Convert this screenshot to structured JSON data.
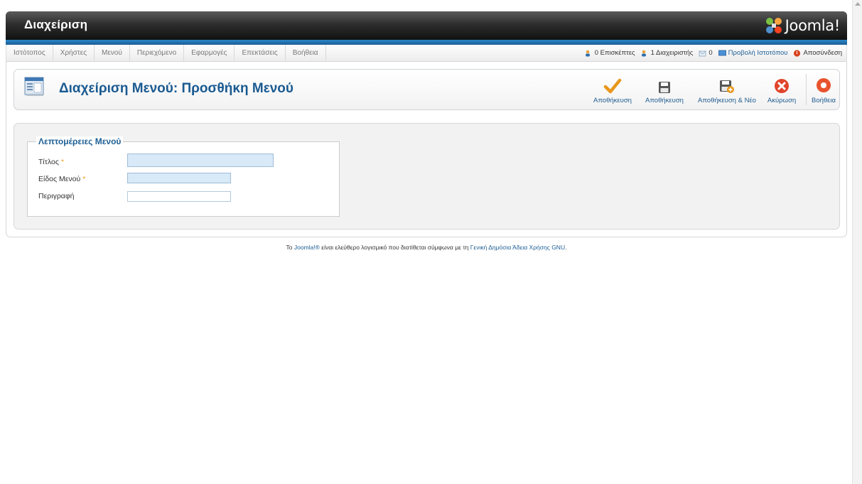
{
  "header": {
    "title": "Διαχείριση",
    "logo_text": "Joomla!"
  },
  "menu": {
    "items": [
      "Ιστότοπος",
      "Χρήστες",
      "Μενού",
      "Περιεχόμενο",
      "Εφαρμογές",
      "Επεκτάσεις",
      "Βοήθεια"
    ]
  },
  "status": {
    "visitors": "0 Επισκέπτες",
    "admins": "1 Διαχειριστής",
    "messages": "0",
    "view_site": "Προβολή Ιστοτόπου",
    "logout": "Αποσύνδεση"
  },
  "toolbar": {
    "page_title": "Διαχείριση Μενού: Προσθήκη Μενού",
    "save_close": "Αποθήκευση",
    "save": "Αποθήκευση",
    "save_new": "Αποθήκευση & Νέο",
    "cancel": "Ακύρωση",
    "help": "Βοήθεια"
  },
  "form": {
    "legend": "Λεπτομέρειες Μενού",
    "title_label": "Τίτλος",
    "menutype_label": "Είδος Μενού",
    "description_label": "Περιγραφή",
    "required_mark": "*",
    "title_value": "",
    "menutype_value": "",
    "description_value": ""
  },
  "footer": {
    "prefix": "Το",
    "joomla_link": "Joomla!®",
    "middle": "είναι ελεύθερο λογισμικό που διατίθεται σύμφωνα με τη",
    "license_link": "Γενική Δημόσια Άδεια Χρήσης GNU",
    "suffix": "."
  },
  "colors": {
    "accent_blue": "#1a5a91",
    "header_dark": "#2e2e2e",
    "required_star": "#f0a020"
  }
}
